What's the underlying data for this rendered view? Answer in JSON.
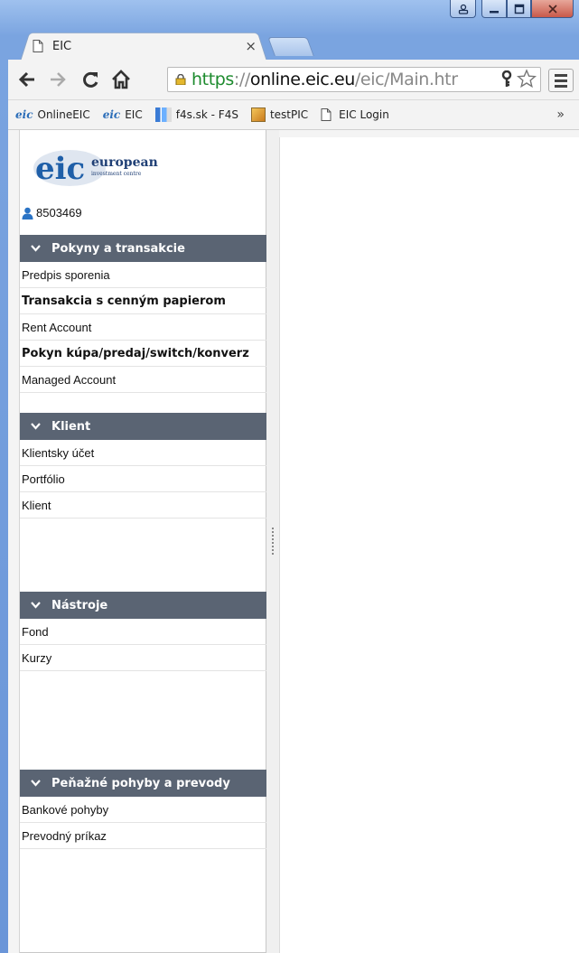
{
  "browser": {
    "tab_title": "EIC",
    "close_glyph": "×",
    "url": {
      "scheme": "https",
      "separator": "://",
      "host": "online.eic.eu",
      "path": "/eic/Main.htr"
    },
    "bookmarks": [
      {
        "label": "OnlineEIC",
        "icon": "eic-favicon"
      },
      {
        "label": "EIC",
        "icon": "eic-favicon"
      },
      {
        "label": "f4s.sk - F4S",
        "icon": "f4s-favicon"
      },
      {
        "label": "testPIC",
        "icon": "picture-favicon"
      },
      {
        "label": "EIC Login",
        "icon": "document-icon"
      }
    ],
    "bookmark_icon_text": "eic",
    "more_glyph": "»"
  },
  "logo": {
    "mark": "eic",
    "line1": "european",
    "line2": "investment centre"
  },
  "user": {
    "id": "8503469"
  },
  "sections": [
    {
      "title": "Pokyny a transakcie",
      "items": [
        {
          "label": "Predpis sporenia",
          "bold": false
        },
        {
          "label": "Transakcia s cenným papierom",
          "bold": true
        },
        {
          "label": "Rent Account",
          "bold": false
        },
        {
          "label": "Pokyn kúpa/predaj/switch/konverz",
          "bold": true
        },
        {
          "label": "Managed Account",
          "bold": false
        }
      ]
    },
    {
      "title": "Klient",
      "items": [
        {
          "label": "Klientsky účet",
          "bold": false
        },
        {
          "label": "Portfólio",
          "bold": false
        },
        {
          "label": "Klient",
          "bold": false
        }
      ]
    },
    {
      "title": "Nástroje",
      "items": [
        {
          "label": "Fond",
          "bold": false
        },
        {
          "label": "Kurzy",
          "bold": false
        }
      ]
    },
    {
      "title": "Peňažné pohyby a prevody",
      "items": [
        {
          "label": "Bankové pohyby",
          "bold": false
        },
        {
          "label": "Prevodný príkaz",
          "bold": false
        }
      ]
    }
  ],
  "colors": {
    "section_header": "#5a6473",
    "url_scheme": "#1d8b2e",
    "logo_blue": "#1f5fa8"
  }
}
